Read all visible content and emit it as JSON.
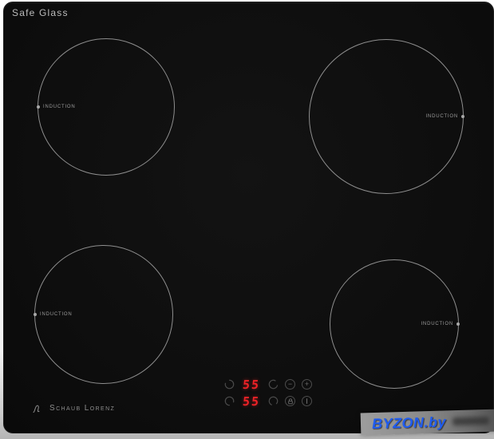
{
  "product": {
    "surface_text": "Safe Glass",
    "brand": "Schaub Lorenz"
  },
  "zones": [
    {
      "id": "back-left",
      "label": "INDUCTION"
    },
    {
      "id": "back-right",
      "label": "INDUCTION"
    },
    {
      "id": "front-left",
      "label": "INDUCTION"
    },
    {
      "id": "front-right",
      "label": "INDUCTION"
    }
  ],
  "controls": {
    "displays": [
      {
        "value": "55"
      },
      {
        "value": "55"
      }
    ],
    "minus_label": "−",
    "plus_label": "+"
  },
  "watermark": {
    "text": "BYZON.by"
  },
  "colors": {
    "display_red": "#ee2227",
    "zone_outline_gray": "#8e8e8e",
    "watermark_blue": "#1f5cf0",
    "surface_black": "#0e0e0e"
  }
}
